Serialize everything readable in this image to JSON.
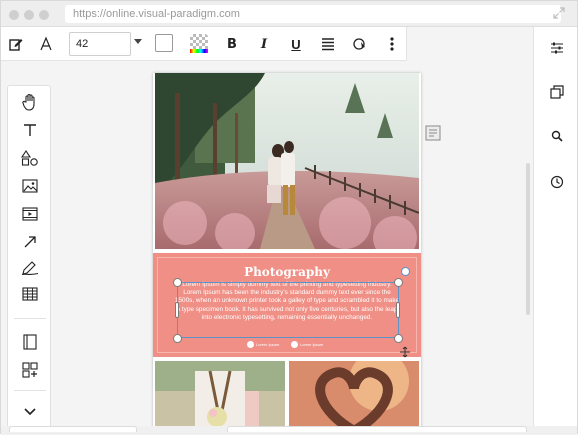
{
  "browser": {
    "url": "https://online.visual-paradigm.com"
  },
  "toolbar": {
    "font_size": "42",
    "bold_label": "B",
    "italic_label": "I",
    "underline_label": "U",
    "edit_icon": "pencil-edit-icon",
    "font_icon": "font-a-icon",
    "align_icon": "align-justify-icon",
    "more_icon": "more-vertical-icon"
  },
  "left_tools": [
    "hand-tool-icon",
    "text-tool-icon",
    "shapes-tool-icon",
    "image-tool-icon",
    "video-tool-icon",
    "arrow-tool-icon",
    "pen-tool-icon",
    "table-tool-icon",
    "pages-panel-icon",
    "add-widget-icon",
    "chevron-down-icon"
  ],
  "right_tools": [
    "settings-sliders-icon",
    "copy-layers-icon",
    "search-icon",
    "history-icon"
  ],
  "document": {
    "heading": "Photography",
    "body": "Lorem Ipsum is simply dummy text of the printing and typesetting industry. Lorem Ipsum has been the industry's standard dummy text ever since the 1500s, when an unknown printer took a galley of type and scrambled it to make a type specimen book. It has survived not only five centuries, but also the leap into electronic typesetting, remaining essentially unchanged.",
    "social_1": "Lorem Ipsum",
    "social_2": "Lorem Ipsum"
  },
  "colors": {
    "accent_pink": "#ef8f86",
    "selection": "#5a93c9"
  }
}
